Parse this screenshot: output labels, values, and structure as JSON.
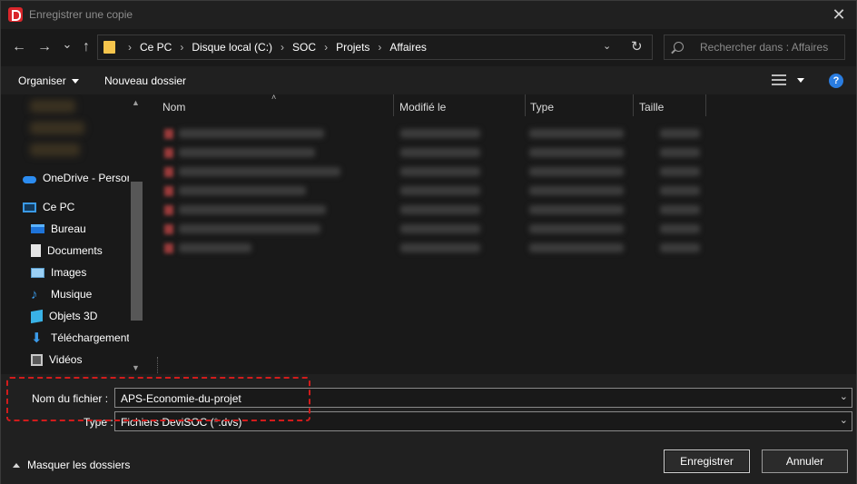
{
  "window": {
    "title": "Enregistrer une copie",
    "close_glyph": "✕",
    "app_icon": "devisoc-app-icon",
    "accent_color": "#d9262b"
  },
  "navigation": {
    "back_glyph": "←",
    "forward_glyph": "→",
    "recent_glyph": "⌄",
    "up_glyph": "↑"
  },
  "address": {
    "breadcrumbs": [
      "Ce PC",
      "Disque local (C:)",
      "SOC",
      "Projets",
      "Affaires"
    ],
    "separator": "›",
    "dropdown_glyph": "⌄",
    "refresh_glyph": "↻"
  },
  "search": {
    "placeholder": "Rechercher dans : Affaires"
  },
  "toolbar": {
    "organize_label": "Organiser",
    "new_folder_label": "Nouveau dossier",
    "help_glyph": "?",
    "help_color": "#2a7de1"
  },
  "nav_pane": {
    "onedrive_label": "OneDrive - Persor",
    "this_pc_label": "Ce PC",
    "items": [
      {
        "label": "Bureau",
        "icon": "desktop-icon"
      },
      {
        "label": "Documents",
        "icon": "documents-icon"
      },
      {
        "label": "Images",
        "icon": "pictures-icon"
      },
      {
        "label": "Musique",
        "icon": "music-icon"
      },
      {
        "label": "Objets 3D",
        "icon": "3d-objects-icon"
      },
      {
        "label": "Téléchargements",
        "icon": "downloads-icon"
      },
      {
        "label": "Vidéos",
        "icon": "videos-icon"
      }
    ],
    "music_glyph": "♪",
    "download_glyph": "⬇"
  },
  "file_list": {
    "columns": [
      "Nom",
      "Modifié le",
      "Type",
      "Taille"
    ],
    "sort_glyph": "˄",
    "blurred_row_count_note": ""
  },
  "form": {
    "filename_label": "Nom du fichier :",
    "filename_value": "APS-Economie-du-projet",
    "type_label": "Type :",
    "type_value": "Fichiers DeviSOC (*.dvs)",
    "dropdown_glyph": "⌄"
  },
  "footer": {
    "hide_folders_label": "Masquer les dossiers",
    "save_label": "Enregistrer",
    "cancel_label": "Annuler"
  },
  "highlight_color": "#d11c1c"
}
